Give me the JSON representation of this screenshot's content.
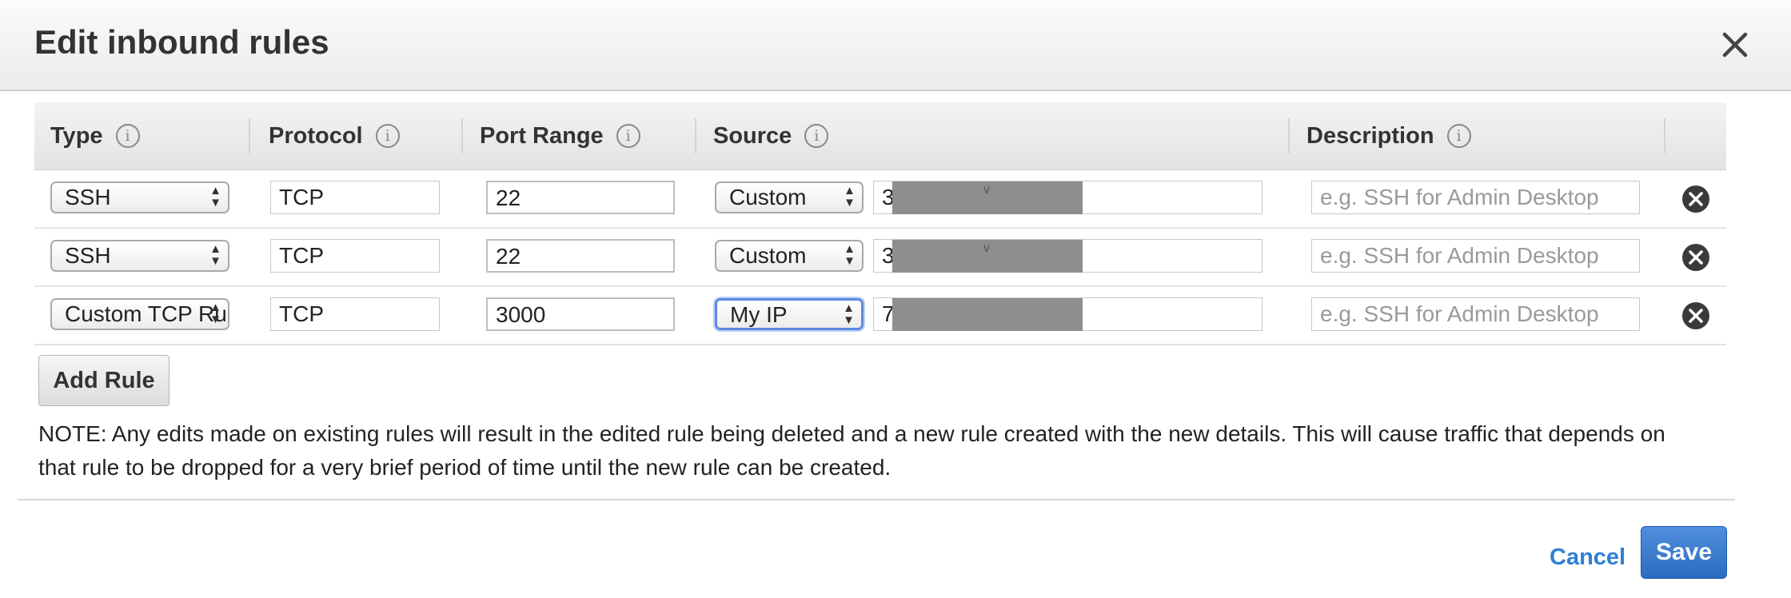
{
  "dialog": {
    "title": "Edit inbound rules",
    "close_icon": "close-icon"
  },
  "table": {
    "headers": {
      "type": "Type",
      "protocol": "Protocol",
      "port_range": "Port Range",
      "source": "Source",
      "description": "Description"
    },
    "info_glyph": "i",
    "rows": [
      {
        "type": "SSH",
        "protocol": "TCP",
        "port_range": "22",
        "source_select": "Custom",
        "source_value": "34",
        "description_placeholder": "e.g. SSH for Admin Desktop"
      },
      {
        "type": "SSH",
        "protocol": "TCP",
        "port_range": "22",
        "source_select": "Custom",
        "source_value": "34",
        "description_placeholder": "e.g. SSH for Admin Desktop"
      },
      {
        "type": "Custom TCP Rule",
        "protocol": "TCP",
        "port_range": "3000",
        "source_select": "My IP",
        "source_value": "74",
        "description_placeholder": "e.g. SSH for Admin Desktop"
      }
    ]
  },
  "actions": {
    "add_rule": "Add Rule",
    "cancel": "Cancel",
    "save": "Save"
  },
  "note": "NOTE: Any edits made on existing rules will result in the edited rule being deleted and a new rule created with the new details. This will cause traffic that depends on that rule to be dropped for a very brief period of time until the new rule can be created.",
  "colors": {
    "primary_button": "#2c6cc0",
    "link": "#2f7fd4",
    "focus_ring": "#5b8be0",
    "redaction": "#8e8e8e"
  }
}
